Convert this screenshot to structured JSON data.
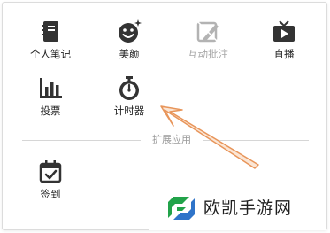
{
  "apps": {
    "notebook_label": "个人笔记",
    "beauty_label": "美颜",
    "interactive_annotation_label": "互动批注",
    "live_label": "直播",
    "vote_label": "投票",
    "timer_label": "计时器",
    "sign_in_label": "签到"
  },
  "section": {
    "extensions_label": "扩展应用"
  },
  "watermark": {
    "text": "欧凯手游网"
  },
  "icons": {
    "notebook": "notebook-icon",
    "beauty": "smiley-sparkle-icon",
    "annotation": "pen-board-icon",
    "live": "tv-play-icon",
    "vote": "bar-chart-icon",
    "timer": "stopwatch-icon",
    "sign_in": "calendar-check-icon",
    "arrow": "annotation-arrow"
  },
  "colors": {
    "icon": "#333333",
    "disabled_icon": "#b3b3b3",
    "arrow": "#e8955a",
    "logo_green": "#22a34a",
    "logo_blue": "#2f74c9"
  }
}
